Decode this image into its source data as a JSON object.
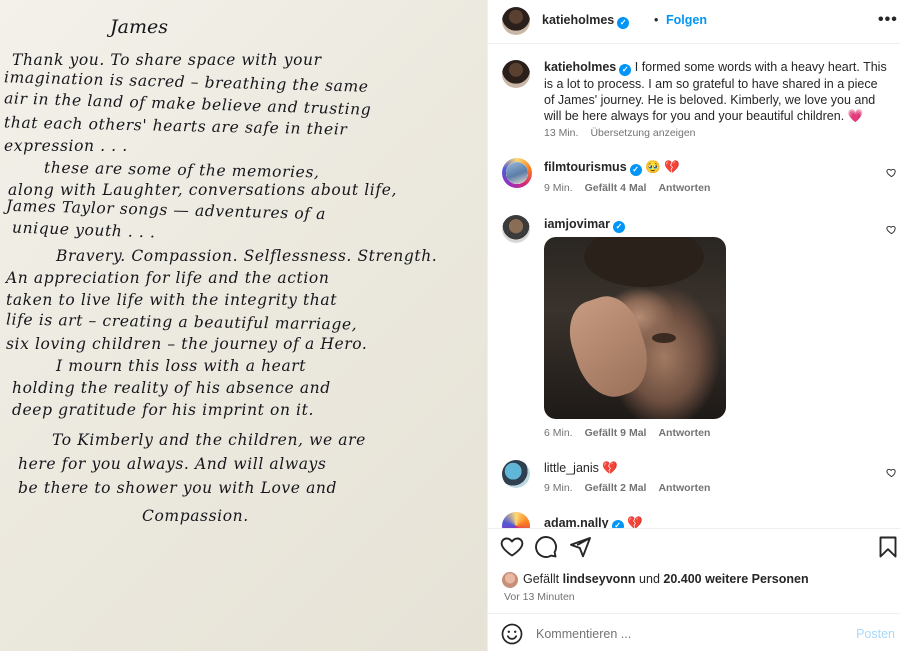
{
  "note": {
    "title": "James",
    "lines": [
      "Thank you. To share space with your",
      "imagination is sacred – breathing the same",
      "air in the land of make believe and trusting",
      "that each others' hearts are safe in their",
      "expression . . .",
      "these are some of the memories,",
      "along with Laughter, conversations about life,",
      "James Taylor songs — adventures of a",
      "unique youth . . .",
      "Bravery. Compassion. Selflessness. Strength.",
      "An appreciation for life and the action",
      "taken to live life with the integrity that",
      "life is art – creating a beautiful marriage,",
      "six loving children – the journey of a Hero.",
      "I mourn this loss with a heart",
      "holding the reality of his absence and",
      "deep gratitude for his imprint on it.",
      "To Kimberly and the children, we are",
      "here for you always. And will always",
      "be there to shower you with Love and",
      "Compassion."
    ]
  },
  "header": {
    "username": "katieholmes",
    "separator": "•",
    "follow_label": "Folgen",
    "more_label": "•••"
  },
  "caption": {
    "username": "katieholmes",
    "text": "I formed some words with a heavy heart. This is a lot to process. I am so grateful to have shared in a piece of James' journey. He is beloved. Kimberly, we love you and will be here always for you and your beautiful children.",
    "emoji": "💗",
    "time": "13 Min.",
    "translate": "Übersetzung anzeigen"
  },
  "comments": [
    {
      "username": "filmtourismus",
      "text": "🥹 💔",
      "time": "9 Min.",
      "likes": "Gefällt 4 Mal",
      "reply": "Antworten"
    },
    {
      "username": "iamjovimar",
      "text": "",
      "time": "6 Min.",
      "likes": "Gefällt 9 Mal",
      "reply": "Antworten"
    },
    {
      "username": "little_janis",
      "text": "💔",
      "time": "9 Min.",
      "likes": "Gefällt 2 Mal",
      "reply": "Antworten"
    },
    {
      "username": "adam.nally",
      "text": "💔"
    }
  ],
  "likes": {
    "prefix": "Gefällt",
    "user": "lindseyvonn",
    "middle": "und",
    "others": "20.400 weitere Personen",
    "time_ago": "Vor 13 Minuten"
  },
  "comment_box": {
    "placeholder": "Kommentieren ...",
    "post_label": "Posten"
  },
  "colors": {
    "accent": "#0095f6",
    "heart": "#ed4956",
    "meta": "#737373"
  }
}
